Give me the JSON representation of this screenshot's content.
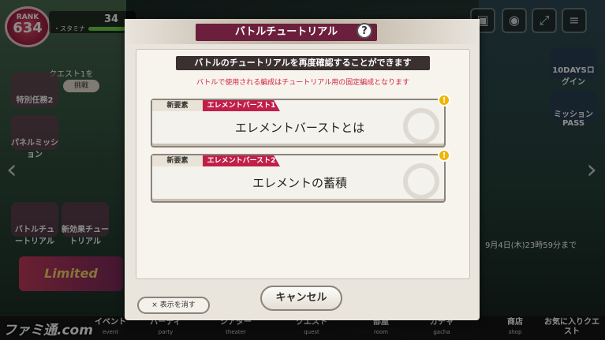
{
  "hud": {
    "rank_label": "RANK",
    "rank_value": "634",
    "currency_value": "34",
    "stamina_label": "・スタミナ",
    "quest_text": "クエスト1を",
    "challenge_label": "挑戦"
  },
  "left_menu": {
    "special": "特別任務2",
    "panel_mission": "パネルミッション",
    "battle_tutorial": "バトルチュートリアル",
    "new_effect_tutorial": "新効果チュートリアル",
    "limited": "Limited"
  },
  "right_menu": {
    "ten_days_login": "10DAYSログイン",
    "mission_pass": "ミッションPASS",
    "event_deadline": "9月4日(木)23時59分まで"
  },
  "bottom_nav": [
    {
      "label": "イベント",
      "sub": "event"
    },
    {
      "label": "パーティ",
      "sub": "party"
    },
    {
      "label": "シアター",
      "sub": "theater"
    },
    {
      "label": "クエスト",
      "sub": "quest"
    },
    {
      "label": "部屋",
      "sub": "room"
    },
    {
      "label": "ガチャ",
      "sub": "gacha"
    },
    {
      "label": "商店",
      "sub": "shop"
    },
    {
      "label": "お気に入りクエスト",
      "sub": ""
    }
  ],
  "watermark": "ファミ通.com",
  "modal": {
    "title": "バトルチュートリアル",
    "help_icon": "?",
    "notice": "バトルのチュートリアルを再度確認することができます",
    "subnotice": "バトルで使用される編成はチュートリアル用の固定編成となります",
    "items": [
      {
        "new_tag": "新要素",
        "burst_tag": "エレメントバースト1",
        "label": "エレメントバーストとは",
        "alert": "!"
      },
      {
        "new_tag": "新要素",
        "burst_tag": "エレメントバースト2",
        "label": "エレメントの蓄積",
        "alert": "!"
      }
    ],
    "hide_label": "× 表示を消す",
    "cancel_label": "キャンセル"
  }
}
